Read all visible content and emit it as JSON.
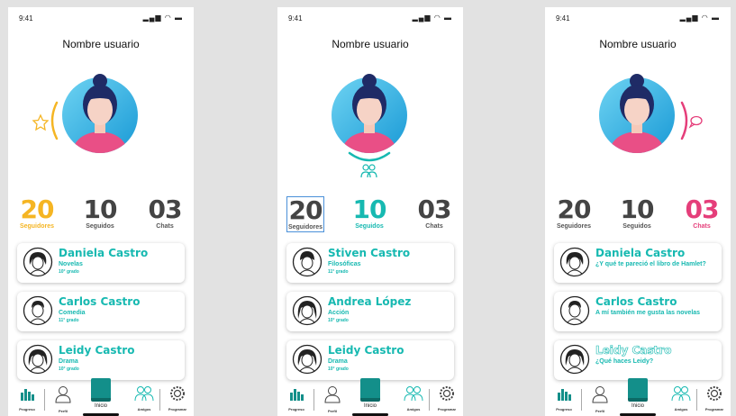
{
  "colors": {
    "teal": "#17b9b1",
    "yellow": "#f5b523",
    "pink": "#e53e7a",
    "gray": "#444444",
    "background": "#e2e2e2"
  },
  "screens": [
    {
      "status_time": "9:41",
      "title": "Nombre usuario",
      "side_icon": "star-icon",
      "stats": [
        {
          "num": "20",
          "label": "Seguidores"
        },
        {
          "num": "10",
          "label": "Seguidos"
        },
        {
          "num": "03",
          "label": "Chats"
        }
      ],
      "cards": [
        {
          "name": "Daniela Castro",
          "sub": "Novelas",
          "grade": "10° grado"
        },
        {
          "name": "Carlos Castro",
          "sub": "Comedia",
          "grade": "11° grado"
        },
        {
          "name": "Leidy Castro",
          "sub": "Drama",
          "grade": "10° grado"
        }
      ]
    },
    {
      "status_time": "9:41",
      "title": "Nombre usuario",
      "side_icon": "friends-icon",
      "stats": [
        {
          "num": "20",
          "label": "Seguidores"
        },
        {
          "num": "10",
          "label": "Seguidos"
        },
        {
          "num": "03",
          "label": "Chats"
        }
      ],
      "cards": [
        {
          "name": "Stiven Castro",
          "sub": "Filosóficas",
          "grade": "11° grado"
        },
        {
          "name": "Andrea López",
          "sub": "Acción",
          "grade": "10° grado"
        },
        {
          "name": "Leidy Castro",
          "sub": "Drama",
          "grade": "10° grado"
        }
      ]
    },
    {
      "status_time": "9:41",
      "title": "Nombre usuario",
      "side_icon": "chat-bubble-icon",
      "stats": [
        {
          "num": "20",
          "label": "Seguidores"
        },
        {
          "num": "10",
          "label": "Seguidos"
        },
        {
          "num": "03",
          "label": "Chats"
        }
      ],
      "cards": [
        {
          "name": "Daniela Castro",
          "msg": "¿Y qué te pareció el libro de Hamlet?"
        },
        {
          "name": "Carlos Castro",
          "msg": "A mí también me gusta las novelas"
        },
        {
          "name": "Leidy Castro",
          "msg": "¿Qué haces Leidy?"
        }
      ]
    }
  ],
  "nav": {
    "progreso": "Progreso",
    "perfil": "Perfil",
    "inicio": "Inicio",
    "amigos": "Amigos",
    "programar": "Programar"
  }
}
